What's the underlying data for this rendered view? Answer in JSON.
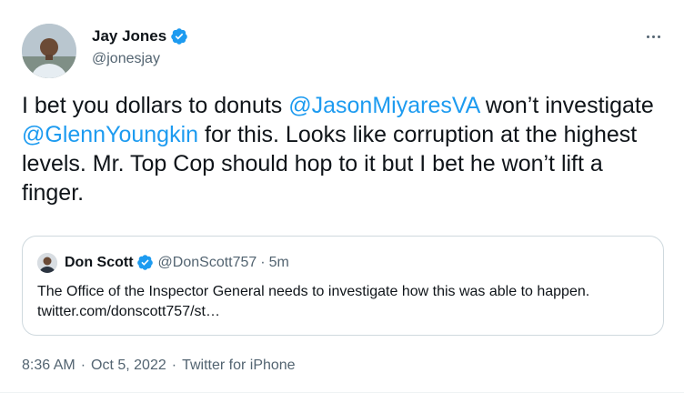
{
  "author": {
    "name": "Jay Jones",
    "handle": "@jonesjay"
  },
  "tweet": {
    "text_1": "I bet you dollars to donuts ",
    "mention_1": "@JasonMiyaresVA",
    "text_2": " won’t investigate ",
    "mention_2": "@GlennYoungkin",
    "text_3": " for this. Looks like corruption at the highest levels. Mr. Top Cop should hop to it but I bet he won’t lift a finger."
  },
  "quoted": {
    "name": "Don Scott",
    "handle": "@DonScott757",
    "separator": "·",
    "time": "5m",
    "text": "The Office of the Inspector General needs to investigate how this was able to happen. twitter.com/donscott757/st…"
  },
  "meta": {
    "time": "8:36 AM",
    "sep1": "·",
    "date": "Oct 5, 2022",
    "sep2": "·",
    "source": "Twitter for iPhone"
  },
  "colors": {
    "accent": "#1d9bf0",
    "text": "#0f1419",
    "secondary": "#536471",
    "border": "#cfd9de"
  },
  "icons": {
    "verified": "verified-badge-icon",
    "more": "more-options-icon"
  }
}
